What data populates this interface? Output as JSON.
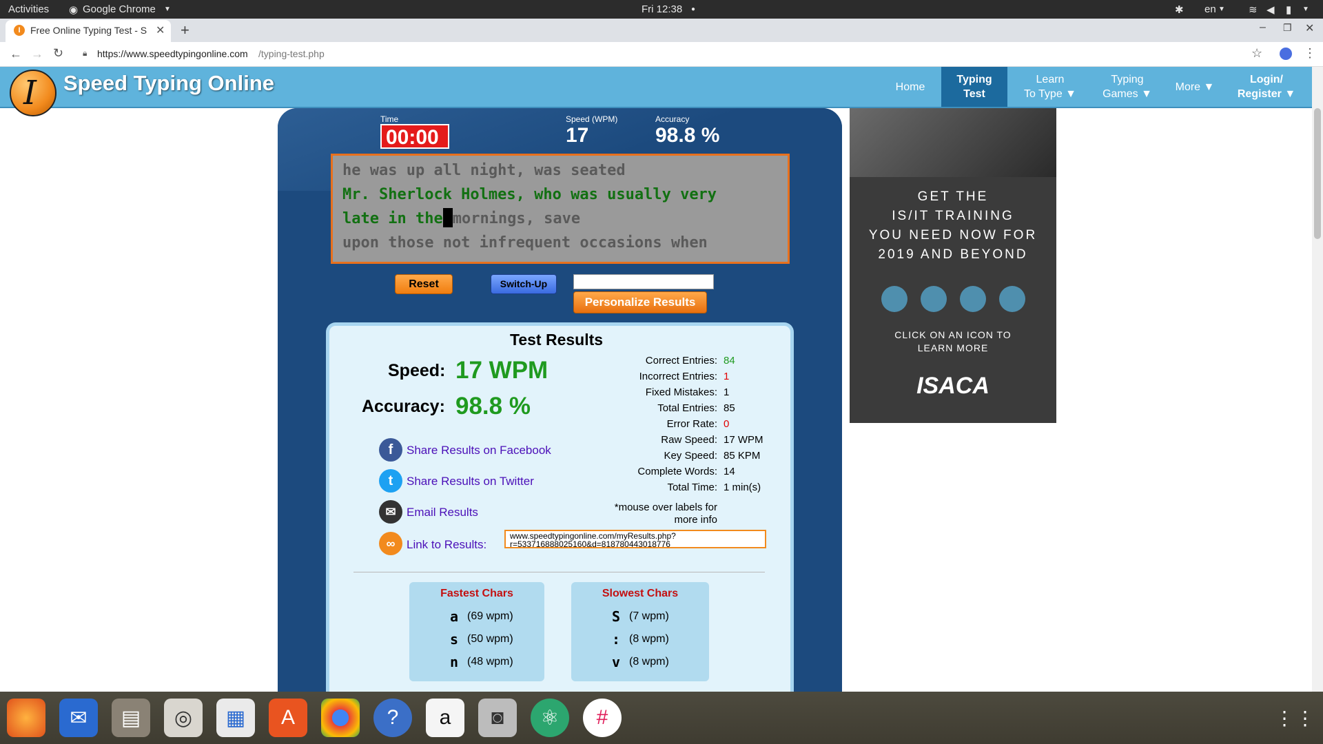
{
  "system": {
    "activities": "Activities",
    "app_name": "Google Chrome",
    "clock": "Fri 12:38",
    "lang": "en"
  },
  "browser": {
    "tab_title": "Free Online Typing Test - S",
    "url_domain": "https://www.speedtypingonline.com",
    "url_path": "/typing-test.php"
  },
  "site": {
    "logo_text": "Speed Typing Online",
    "nav": [
      {
        "line1": "Home",
        "line2": ""
      },
      {
        "line1": "Typing",
        "line2": "Test"
      },
      {
        "line1": "Learn",
        "line2": "To Type ▼"
      },
      {
        "line1": "Typing",
        "line2": "Games ▼"
      },
      {
        "line1": "More ▼",
        "line2": ""
      },
      {
        "line1": "Login/",
        "line2": "Register ▼"
      }
    ]
  },
  "stats": {
    "time_label": "Time",
    "time_value": "00:00",
    "speed_label": "Speed (WPM)",
    "speed_value": "17",
    "accuracy_label": "Accuracy",
    "accuracy_value": "98.8 %"
  },
  "typing_text": {
    "line1": "he was up all night, was seated",
    "line2": "Mr. Sherlock Holmes, who was usually very",
    "line3_typed": "late in the",
    "line3_rest": "mornings, save",
    "line4": "upon those not infrequent occasions when"
  },
  "controls": {
    "reset": "Reset",
    "switch_up": "Switch-Up",
    "name_input": "",
    "personalize": "Personalize Results"
  },
  "results": {
    "title": "Test Results",
    "speed_label": "Speed:",
    "speed_value": "17 WPM",
    "accuracy_label": "Accuracy:",
    "accuracy_value": "98.8 %",
    "details": [
      {
        "label": "Correct Entries:",
        "value": "84",
        "color": "#1f9a1f"
      },
      {
        "label": "Incorrect Entries:",
        "value": "1",
        "color": "#e00000"
      },
      {
        "label": "Fixed Mistakes:",
        "value": "1",
        "color": "#000000"
      },
      {
        "label": "Total Entries:",
        "value": "85",
        "color": "#000000"
      },
      {
        "label": "Error Rate:",
        "value": "0",
        "color": "#e00000"
      },
      {
        "label": "Raw Speed:",
        "value": "17 WPM",
        "color": "#000000"
      },
      {
        "label": "Key Speed:",
        "value": "85 KPM",
        "color": "#000000"
      },
      {
        "label": "Complete Words:",
        "value": "14",
        "color": "#000000"
      },
      {
        "label": "Total Time:",
        "value": "1 min(s)",
        "color": "#000000"
      }
    ],
    "note_line1": "*mouse over labels for",
    "note_line2": "more info",
    "share_facebook": "Share Results on Facebook",
    "share_twitter": "Share Results on Twitter",
    "email": "Email Results",
    "link_label": "Link to Results:",
    "link_line1": "www.speedtypingonline.com/myResults.php?",
    "link_line2": "r=533716888025160&d=818780443018776",
    "fastest_title": "Fastest Chars",
    "fastest": [
      {
        "char": "a",
        "wpm": "(69 wpm)"
      },
      {
        "char": "s",
        "wpm": "(50 wpm)"
      },
      {
        "char": "n",
        "wpm": "(48 wpm)"
      }
    ],
    "slowest_title": "Slowest Chars",
    "slowest": [
      {
        "char": "S",
        "wpm": "(7 wpm)"
      },
      {
        "char": ":",
        "wpm": "(8 wpm)"
      },
      {
        "char": "v",
        "wpm": "(8 wpm)"
      }
    ]
  },
  "ad": {
    "line1": "GET THE",
    "line2": "IS/IT TRAINING",
    "line3": "YOU NEED NOW FOR",
    "line4": "2019 AND BEYOND",
    "cta1": "CLICK ON AN ICON TO",
    "cta2": "LEARN MORE",
    "brand": "ISACA"
  },
  "colors": {
    "accent_orange": "#f28a1d",
    "header_blue": "#5fb3dc",
    "panel_blue": "#1c4a7e",
    "timer_red": "#e41b1b",
    "result_green": "#1f9a1f"
  }
}
